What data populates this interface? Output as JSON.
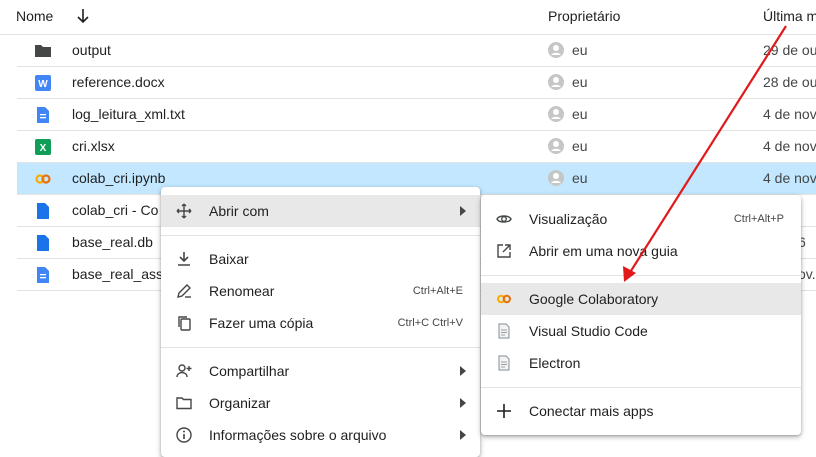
{
  "header": {
    "name": "Nome",
    "owner": "Proprietário",
    "modified": "Última m"
  },
  "files": [
    {
      "name": "output",
      "owner": "eu",
      "date": "29 de ou",
      "icon": "folder-icon"
    },
    {
      "name": "reference.docx",
      "owner": "eu",
      "date": "28 de ou",
      "icon": "word-doc-icon"
    },
    {
      "name": "log_leitura_xml.txt",
      "owner": "eu",
      "date": "4 de nov",
      "icon": "text-doc-icon"
    },
    {
      "name": "cri.xlsx",
      "owner": "eu",
      "date": "4 de nov",
      "icon": "excel-icon"
    },
    {
      "name": "colab_cri.ipynb",
      "owner": "eu",
      "date": "4 de nov",
      "icon": "colab-icon",
      "selected": true
    },
    {
      "name": "colab_cri - Co",
      "owner": "",
      "date": "",
      "icon": "doc-icon"
    },
    {
      "name": "base_real.db",
      "owner": "",
      "date": "",
      "icon": "doc-icon"
    },
    {
      "name": "base_real_ass",
      "owner": "",
      "date": "",
      "icon": "text-doc-icon"
    }
  ],
  "context_menu": {
    "open_with": "Abrir com",
    "download": "Baixar",
    "rename": "Renomear",
    "rename_shortcut": "Ctrl+Alt+E",
    "copy": "Fazer uma cópia",
    "copy_shortcut": "Ctrl+C Ctrl+V",
    "share": "Compartilhar",
    "organize": "Organizar",
    "file_info": "Informações sobre o arquivo"
  },
  "submenu": {
    "preview": "Visualização",
    "preview_shortcut": "Ctrl+Alt+P",
    "new_tab": "Abrir em uma nova guia",
    "colab": "Google Colaboratory",
    "vscode": "Visual Studio Code",
    "electron": "Electron",
    "more_apps": "Conectar mais apps"
  },
  "partial_dates": {
    "r5": "",
    "r6": "6",
    "r7": "ov."
  },
  "colors": {
    "selected_row": "#c2e7ff",
    "accent_blue": "#4285f4",
    "annotation_arrow": "#e01a1a"
  }
}
